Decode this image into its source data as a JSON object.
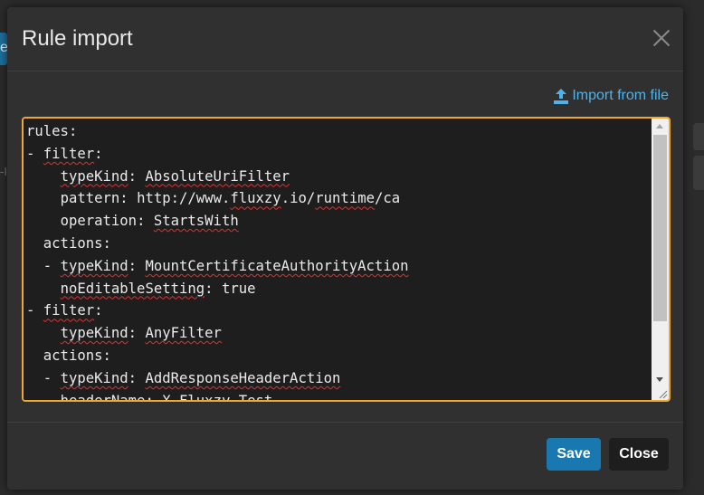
{
  "background": {
    "left_fragment_text": "e",
    "left_text_fragment": "-I"
  },
  "dialog": {
    "title": "Rule import",
    "close_icon": "close-icon",
    "import_link": {
      "icon": "upload-icon",
      "label": "Import from file"
    },
    "editor": {
      "lines": [
        "rules:",
        "- filter:",
        "    typeKind: AbsoluteUriFilter",
        "    pattern: http://www.fluxzy.io/runtime/ca",
        "    operation: StartsWith",
        "  actions:",
        "  - typeKind: MountCertificateAuthorityAction",
        "    noEditableSetting: true",
        "- filter:",
        "    typeKind: AnyFilter",
        "  actions:",
        "  - typeKind: AddResponseHeaderAction",
        "    headerName: X-Fluxzy-Test"
      ]
    },
    "footer": {
      "save_label": "Save",
      "close_label": "Close"
    }
  },
  "colors": {
    "accent": "#4fb3ea",
    "primary_button": "#1a78b0",
    "focus_border": "#f1a72b",
    "spell_error": "#e03131"
  }
}
